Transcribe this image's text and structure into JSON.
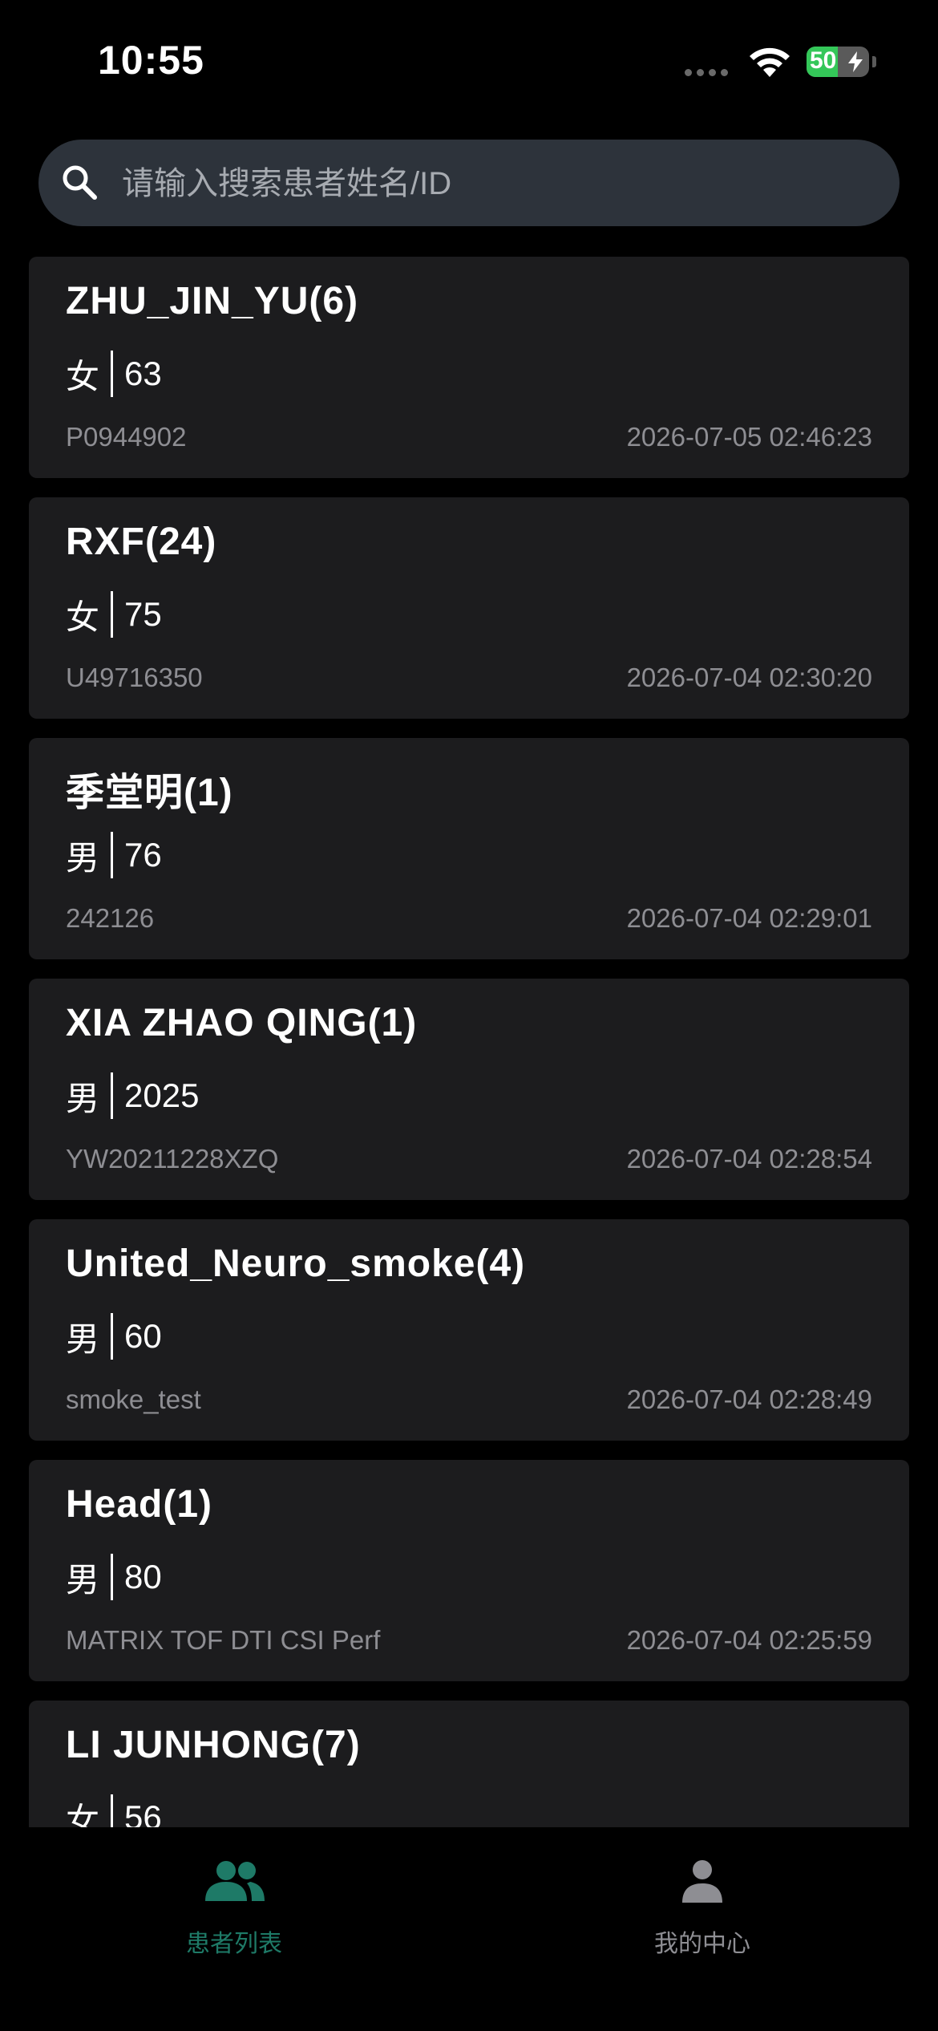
{
  "status_bar": {
    "time": "10:55",
    "battery_level": "50",
    "battery_fraction": 0.5
  },
  "search": {
    "placeholder": "请输入搜索患者姓名/ID",
    "value": ""
  },
  "patients": [
    {
      "name": "ZHU_JIN_YU(6)",
      "gender": "女",
      "age": "63",
      "id": "P0944902",
      "time": "2026-07-05 02:46:23"
    },
    {
      "name": "RXF(24)",
      "gender": "女",
      "age": "75",
      "id": "U49716350",
      "time": "2026-07-04 02:30:20"
    },
    {
      "name": "季堂明(1)",
      "gender": "男",
      "age": "76",
      "id": "242126",
      "time": "2026-07-04 02:29:01"
    },
    {
      "name": "XIA ZHAO QING(1)",
      "gender": "男",
      "age": "2025",
      "id": "YW20211228XZQ",
      "time": "2026-07-04 02:28:54"
    },
    {
      "name": "United_Neuro_smoke(4)",
      "gender": "男",
      "age": "60",
      "id": "smoke_test",
      "time": "2026-07-04 02:28:49"
    },
    {
      "name": "Head(1)",
      "gender": "男",
      "age": "80",
      "id": "MATRIX TOF DTI CSI Perf",
      "time": "2026-07-04 02:25:59"
    },
    {
      "name": "LI JUNHONG(7)",
      "gender": "女",
      "age": "56",
      "id": "",
      "time": ""
    }
  ],
  "tab_bar": {
    "patients_label": "患者列表",
    "mine_label": "我的中心",
    "active_color": "#1e7a67",
    "inactive_color": "#8e8e93"
  }
}
